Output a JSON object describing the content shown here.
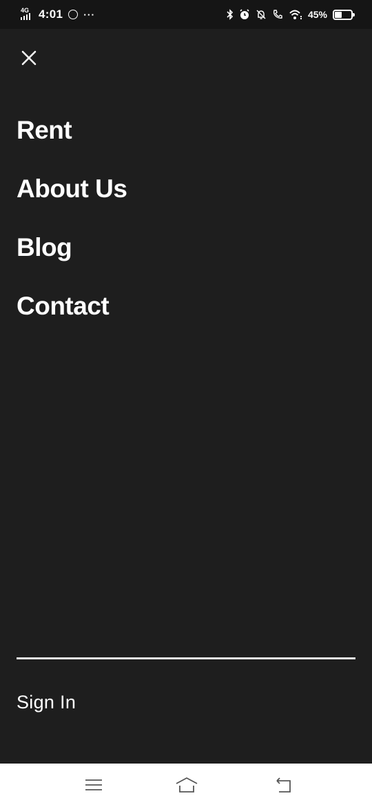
{
  "status_bar": {
    "network": "4G",
    "time": "4:01",
    "more": "···",
    "battery_percent": "45%",
    "battery_level": 0.45,
    "icons": [
      "signal-icon",
      "whatsapp-icon",
      "bluetooth-icon",
      "alarm-icon",
      "mute-icon",
      "call-icon",
      "wifi-icon",
      "battery-icon"
    ]
  },
  "menu": {
    "close_icon": "close-icon",
    "items": [
      {
        "label": "Rent"
      },
      {
        "label": "About Us"
      },
      {
        "label": "Blog"
      },
      {
        "label": "Contact"
      }
    ],
    "sign_in": "Sign In"
  },
  "nav_bar": {
    "icons": [
      "recents-menu-icon",
      "home-icon",
      "back-icon"
    ]
  },
  "colors": {
    "background": "#1e1e1e",
    "status_bar": "#151515",
    "text": "#ffffff",
    "divider": "#e8e8e8",
    "nav_bar": "#ffffff"
  }
}
